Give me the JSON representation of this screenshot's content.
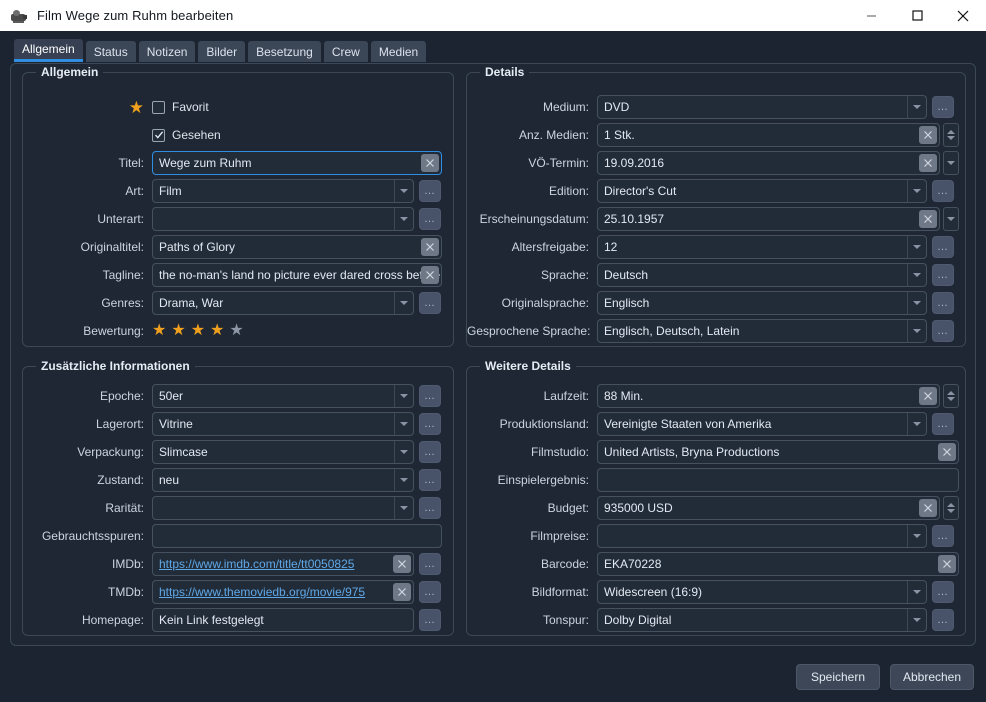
{
  "window": {
    "title": "Film Wege zum Ruhm bearbeiten",
    "icon": "projector-icon",
    "minimize": "minimize-icon",
    "maximize": "maximize-icon",
    "close": "close-icon"
  },
  "tabs": [
    {
      "label": "Allgemein",
      "active": true
    },
    {
      "label": "Status",
      "active": false
    },
    {
      "label": "Notizen",
      "active": false
    },
    {
      "label": "Bilder",
      "active": false
    },
    {
      "label": "Besetzung",
      "active": false
    },
    {
      "label": "Crew",
      "active": false
    },
    {
      "label": "Medien",
      "active": false
    }
  ],
  "colors": {
    "accent": "#2f8ee0",
    "star_on": "#f0a01e",
    "star_off": "#8d96a4",
    "panel_bg": "#1e2733",
    "window_bg": "#1b2430",
    "titlebar_bg": "#ffffff",
    "link": "#5fa8e8"
  },
  "groups": {
    "allgemein": {
      "title": "Allgemein",
      "favorit": {
        "label": "Favorit",
        "checked": false
      },
      "gesehen": {
        "label": "Gesehen",
        "checked": true
      },
      "rating": {
        "label": "Bewertung:",
        "value": 4,
        "max": 5
      },
      "fields": [
        {
          "label": "Titel:",
          "value": "Wege zum Ruhm",
          "name": "titel"
        },
        {
          "label": "Art:",
          "value": "Film",
          "name": "art"
        },
        {
          "label": "Unterart:",
          "value": "",
          "name": "unterart"
        },
        {
          "label": "Originaltitel:",
          "value": "Paths of Glory",
          "name": "originaltitel"
        },
        {
          "label": "Tagline:",
          "value": "the no-man's land no picture ever dared cross before!",
          "name": "tagline"
        },
        {
          "label": "Genres:",
          "value": "Drama, War",
          "name": "genres"
        }
      ]
    },
    "zusaetzliche": {
      "title": "Zusätzliche Informationen",
      "fields": [
        {
          "label": "Epoche:",
          "value": "50er",
          "name": "epoche"
        },
        {
          "label": "Lagerort:",
          "value": "Vitrine",
          "name": "lagerort"
        },
        {
          "label": "Verpackung:",
          "value": "Slimcase",
          "name": "verpackung"
        },
        {
          "label": "Zustand:",
          "value": "neu",
          "name": "zustand"
        },
        {
          "label": "Rarität:",
          "value": "",
          "name": "raritaet"
        },
        {
          "label": "Gebrauchtsspuren:",
          "value": "",
          "name": "gebrauchtsspuren"
        },
        {
          "label": "IMDb:",
          "value": "https://www.imdb.com/title/tt0050825",
          "name": "imdb"
        },
        {
          "label": "TMDb:",
          "value": "https://www.themoviedb.org/movie/975",
          "name": "tmdb"
        },
        {
          "label": "Homepage:",
          "value": "Kein Link festgelegt",
          "name": "homepage"
        }
      ]
    },
    "details": {
      "title": "Details",
      "fields": [
        {
          "label": "Medium:",
          "value": "DVD",
          "name": "medium"
        },
        {
          "label": "Anz. Medien:",
          "value": "1 Stk.",
          "name": "anz-medien"
        },
        {
          "label": "VÖ-Termin:",
          "value": "19.09.2016",
          "name": "voe-termin"
        },
        {
          "label": "Edition:",
          "value": "Director's Cut",
          "name": "edition"
        },
        {
          "label": "Erscheinungsdatum:",
          "value": "25.10.1957",
          "name": "erscheinungsdatum"
        },
        {
          "label": "Altersfreigabe:",
          "value": "12",
          "name": "altersfreigabe"
        },
        {
          "label": "Sprache:",
          "value": "Deutsch",
          "name": "sprache"
        },
        {
          "label": "Originalsprache:",
          "value": "Englisch",
          "name": "originalsprache"
        },
        {
          "label": "Gesprochene Sprache:",
          "value": "Englisch, Deutsch, Latein",
          "name": "gesprochene-sprache"
        }
      ]
    },
    "weitere": {
      "title": "Weitere Details",
      "fields": [
        {
          "label": "Laufzeit:",
          "value": "88 Min.",
          "name": "laufzeit"
        },
        {
          "label": "Produktionsland:",
          "value": "Vereinigte Staaten von Amerika",
          "name": "produktionsland"
        },
        {
          "label": "Filmstudio:",
          "value": "United Artists, Bryna Productions",
          "name": "filmstudio"
        },
        {
          "label": "Einspielergebnis:",
          "value": "",
          "name": "einspielergebnis"
        },
        {
          "label": "Budget:",
          "value": "935000 USD",
          "name": "budget"
        },
        {
          "label": "Filmpreise:",
          "value": "",
          "name": "filmpreise"
        },
        {
          "label": "Barcode:",
          "value": "EKA70228",
          "name": "barcode"
        },
        {
          "label": "Bildformat:",
          "value": "Widescreen (16:9)",
          "name": "bildformat"
        },
        {
          "label": "Tonspur:",
          "value": "Dolby Digital",
          "name": "tonspur"
        }
      ]
    }
  },
  "footer": {
    "save_label": "Speichern",
    "cancel_label": "Abbrechen"
  },
  "ellipsis_label": "…"
}
